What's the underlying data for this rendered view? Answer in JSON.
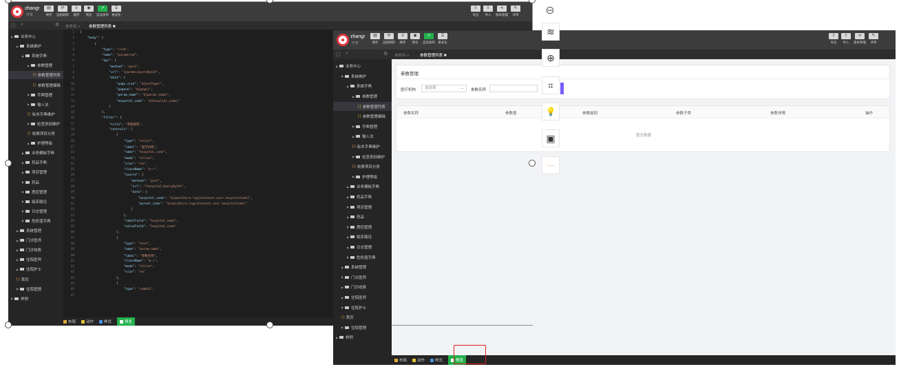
{
  "user": {
    "name": "zhangr",
    "role": "开发"
  },
  "toolbar_left": [
    {
      "icon": "save-icon",
      "label": "保存"
    },
    {
      "icon": "refresh-icon",
      "label": "远程刷新"
    },
    {
      "icon": "sort-icon",
      "label": "顺序"
    },
    {
      "icon": "eye-icon",
      "label": "预览"
    },
    {
      "icon": "publish-icon",
      "label": "自动发布"
    },
    {
      "icon": "format-icon",
      "label": "格式化"
    }
  ],
  "toolbar_right": [
    {
      "icon": "export-icon",
      "label": "导出"
    },
    {
      "icon": "import-icon",
      "label": "导入"
    },
    {
      "icon": "version-icon",
      "label": "版本管理"
    },
    {
      "icon": "review-icon",
      "label": "评审"
    }
  ],
  "tabs": [
    {
      "label": "未命名",
      "close": "×",
      "active": false
    },
    {
      "label": "参数管理列表",
      "close": "✖",
      "active": true
    }
  ],
  "tree_back": [
    {
      "d": 0,
      "t": "open",
      "label": "业务中心"
    },
    {
      "d": 1,
      "t": "open",
      "label": "系统维护"
    },
    {
      "d": 2,
      "t": "open",
      "label": "系统字典"
    },
    {
      "d": 3,
      "t": "open",
      "label": "参数管理"
    },
    {
      "d": 4,
      "t": "code",
      "label": "参数管理列表",
      "sel": true
    },
    {
      "d": 4,
      "t": "code",
      "label": "参数管理编辑"
    },
    {
      "d": 3,
      "t": "folder",
      "label": "字典管理"
    },
    {
      "d": 3,
      "t": "folder",
      "label": "输入法"
    },
    {
      "d": 3,
      "t": "code",
      "label": "标本字典维护"
    },
    {
      "d": 3,
      "t": "folder",
      "label": "检查类别维护"
    },
    {
      "d": 3,
      "t": "code",
      "label": "收费项目分类"
    },
    {
      "d": 3,
      "t": "folder",
      "label": "护理等级"
    },
    {
      "d": 2,
      "t": "folder",
      "label": "业务模板字典"
    },
    {
      "d": 2,
      "t": "folder",
      "label": "药品字典"
    },
    {
      "d": 2,
      "t": "folder",
      "label": "项目管理"
    },
    {
      "d": 2,
      "t": "folder",
      "label": "药品"
    },
    {
      "d": 2,
      "t": "folder",
      "label": "质控管理"
    },
    {
      "d": 2,
      "t": "folder",
      "label": "临床路径"
    },
    {
      "d": 2,
      "t": "folder",
      "label": "日志管理"
    },
    {
      "d": 2,
      "t": "folder",
      "label": "危机值字典"
    },
    {
      "d": 1,
      "t": "folder",
      "label": "系统管理"
    },
    {
      "d": 1,
      "t": "folder",
      "label": "门诊医师"
    },
    {
      "d": 1,
      "t": "folder",
      "label": "门诊收费"
    },
    {
      "d": 1,
      "t": "folder",
      "label": "住院医师"
    },
    {
      "d": 1,
      "t": "folder",
      "label": "住院护士"
    },
    {
      "d": 1,
      "t": "code",
      "label": "首页"
    },
    {
      "d": 1,
      "t": "folder",
      "label": "住院管理"
    },
    {
      "d": 0,
      "t": "folder",
      "label": "样例"
    }
  ],
  "line_numbers": [
    "1",
    "2",
    "3",
    "4",
    "5",
    "6",
    "7",
    "8",
    "9",
    "10",
    "11",
    "12",
    "13",
    "14",
    "15",
    "16",
    "17",
    "18",
    "19",
    "20",
    "21",
    "22",
    "23",
    "24",
    "25",
    "26",
    "27",
    "28",
    "29",
    "30",
    "31",
    "32",
    "33",
    "34",
    "35",
    "36",
    "37",
    "38",
    "39",
    "40",
    "41",
    "42",
    "43",
    "44",
    "45",
    "46",
    "47"
  ],
  "code_lines": [
    [
      [
        "p",
        "{"
      ]
    ],
    [
      [
        "p",
        "    "
      ],
      [
        "k",
        "\"body\""
      ],
      [
        "p",
        ": ["
      ]
    ],
    [
      [
        "p",
        "        {"
      ]
    ],
    [
      [
        "p",
        "            "
      ],
      [
        "k",
        "\"type\""
      ],
      [
        "p",
        ": "
      ],
      [
        "s",
        "\"crud\""
      ],
      [
        "p",
        ","
      ]
    ],
    [
      [
        "p",
        "            "
      ],
      [
        "k",
        "\"name\""
      ],
      [
        "p",
        ": "
      ],
      [
        "s",
        "\"paramcrud\""
      ],
      [
        "p",
        ","
      ]
    ],
    [
      [
        "p",
        "            "
      ],
      [
        "k",
        "\"api\""
      ],
      [
        "p",
        ": {"
      ]
    ],
    [
      [
        "p",
        "                "
      ],
      [
        "k",
        "\"method\""
      ],
      [
        "p",
        ": "
      ],
      [
        "s",
        "\"post\""
      ],
      [
        "p",
        ","
      ]
    ],
    [
      [
        "p",
        "                "
      ],
      [
        "k",
        "\"url\""
      ],
      [
        "p",
        ": "
      ],
      [
        "s",
        "\"/params/queryByCdt\""
      ],
      [
        "p",
        ","
      ]
    ],
    [
      [
        "p",
        "                "
      ],
      [
        "k",
        "\"data\""
      ],
      [
        "p",
        ": {"
      ]
    ],
    [
      [
        "p",
        "                    "
      ],
      [
        "k",
        "\"page_size\""
      ],
      [
        "p",
        ": "
      ],
      [
        "s",
        "\"${perPage}\""
      ],
      [
        "p",
        ","
      ]
    ],
    [
      [
        "p",
        "                    "
      ],
      [
        "k",
        "\"pageno\""
      ],
      [
        "p",
        ": "
      ],
      [
        "s",
        "\"${page}\""
      ],
      [
        "p",
        ","
      ]
    ],
    [
      [
        "p",
        "                    "
      ],
      [
        "k",
        "\"param_name\""
      ],
      [
        "p",
        ": "
      ],
      [
        "s",
        "\"${param_name}\""
      ],
      [
        "p",
        ","
      ]
    ],
    [
      [
        "p",
        "                    "
      ],
      [
        "k",
        "\"hospital_code\""
      ],
      [
        "p",
        ": "
      ],
      [
        "s",
        "\"${hospital_code}\""
      ]
    ],
    [
      [
        "p",
        "                }"
      ]
    ],
    [
      [
        "p",
        "            },"
      ]
    ],
    [
      [
        "p",
        "            "
      ],
      [
        "k",
        "\"filter\""
      ],
      [
        "p",
        ": {"
      ]
    ],
    [
      [
        "p",
        "                "
      ],
      [
        "k",
        "\"title\""
      ],
      [
        "p",
        ": "
      ],
      [
        "s",
        "\"参数管理\""
      ],
      [
        "p",
        ","
      ]
    ],
    [
      [
        "p",
        "                "
      ],
      [
        "k",
        "\"controls\""
      ],
      [
        "p",
        ": ["
      ]
    ],
    [
      [
        "p",
        "                    {"
      ]
    ],
    [
      [
        "p",
        "                        "
      ],
      [
        "k",
        "\"type\""
      ],
      [
        "p",
        ": "
      ],
      [
        "s",
        "\"select\""
      ],
      [
        "p",
        ","
      ]
    ],
    [
      [
        "p",
        "                        "
      ],
      [
        "k",
        "\"label\""
      ],
      [
        "p",
        ": "
      ],
      [
        "s",
        "\"医疗机构\""
      ],
      [
        "p",
        ","
      ]
    ],
    [
      [
        "p",
        "                        "
      ],
      [
        "k",
        "\"name\""
      ],
      [
        "p",
        ": "
      ],
      [
        "s",
        "\"hospital_code\""
      ],
      [
        "p",
        ","
      ]
    ],
    [
      [
        "p",
        "                        "
      ],
      [
        "k",
        "\"mode\""
      ],
      [
        "p",
        ": "
      ],
      [
        "s",
        "\"inline\""
      ],
      [
        "p",
        ","
      ]
    ],
    [
      [
        "p",
        "                        "
      ],
      [
        "k",
        "\"size\""
      ],
      [
        "p",
        ": "
      ],
      [
        "s",
        "\"sm\""
      ],
      [
        "p",
        ","
      ]
    ],
    [
      [
        "p",
        "                        "
      ],
      [
        "k",
        "\"className\""
      ],
      [
        "p",
        ": "
      ],
      [
        "s",
        "\"m-r\""
      ],
      [
        "p",
        ","
      ]
    ],
    [
      [
        "p",
        "                        "
      ],
      [
        "k",
        "\"source\""
      ],
      [
        "p",
        ": {"
      ]
    ],
    [
      [
        "p",
        "                            "
      ],
      [
        "k",
        "\"method\""
      ],
      [
        "p",
        ": "
      ],
      [
        "s",
        "\"post\""
      ],
      [
        "p",
        ","
      ]
    ],
    [
      [
        "p",
        "                            "
      ],
      [
        "k",
        "\"url\""
      ],
      [
        "p",
        ": "
      ],
      [
        "s",
        "\"/hospital/queryByCdt\""
      ],
      [
        "p",
        ","
      ]
    ],
    [
      [
        "p",
        "                            "
      ],
      [
        "k",
        "\"data\""
      ],
      [
        "p",
        ": {"
      ]
    ],
    [
      [
        "p",
        "                                "
      ],
      [
        "k",
        "\"hospital_code\""
      ],
      [
        "p",
        ": "
      ],
      [
        "s",
        "\"${amisStore.loginContext.user.hospitalCode}\""
      ],
      [
        "p",
        ","
      ]
    ],
    [
      [
        "p",
        "                                "
      ],
      [
        "k",
        "\"parent_code\""
      ],
      [
        "p",
        ": "
      ],
      [
        "s",
        "\"${amisStore.loginContext.user.hospitalCode}\""
      ]
    ],
    [
      [
        "p",
        "                            }"
      ]
    ],
    [
      [
        "p",
        "                        },"
      ]
    ],
    [
      [
        "p",
        "                        "
      ],
      [
        "k",
        "\"labelField\""
      ],
      [
        "p",
        ": "
      ],
      [
        "s",
        "\"hospital_name\""
      ],
      [
        "p",
        ","
      ]
    ],
    [
      [
        "p",
        "                        "
      ],
      [
        "k",
        "\"valueField\""
      ],
      [
        "p",
        ": "
      ],
      [
        "s",
        "\"hospital_code\""
      ]
    ],
    [
      [
        "p",
        "                    },"
      ]
    ],
    [
      [
        "p",
        "                    {"
      ]
    ],
    [
      [
        "p",
        "                        "
      ],
      [
        "k",
        "\"type\""
      ],
      [
        "p",
        ": "
      ],
      [
        "s",
        "\"text\""
      ],
      [
        "p",
        ","
      ]
    ],
    [
      [
        "p",
        "                        "
      ],
      [
        "k",
        "\"name\""
      ],
      [
        "p",
        ": "
      ],
      [
        "s",
        "\"param_name\""
      ],
      [
        "p",
        ","
      ]
    ],
    [
      [
        "p",
        "                        "
      ],
      [
        "k",
        "\"label\""
      ],
      [
        "p",
        ": "
      ],
      [
        "s",
        "\"参数名称\""
      ],
      [
        "p",
        ","
      ]
    ],
    [
      [
        "p",
        "                        "
      ],
      [
        "k",
        "\"className\""
      ],
      [
        "p",
        ": "
      ],
      [
        "s",
        "\"m-r\""
      ],
      [
        "p",
        ","
      ]
    ],
    [
      [
        "p",
        "                        "
      ],
      [
        "k",
        "\"mode\""
      ],
      [
        "p",
        ": "
      ],
      [
        "s",
        "\"inline\""
      ],
      [
        "p",
        ","
      ]
    ],
    [
      [
        "p",
        "                        "
      ],
      [
        "k",
        "\"size\""
      ],
      [
        "p",
        ": "
      ],
      [
        "s",
        "\"sm\""
      ]
    ],
    [
      [
        "p",
        "                    },"
      ]
    ],
    [
      [
        "p",
        "                    {"
      ]
    ],
    [
      [
        "p",
        "                        "
      ],
      [
        "k",
        "\"type\""
      ],
      [
        "p",
        ": "
      ],
      [
        "s",
        "\"submit\""
      ],
      [
        "p",
        ","
      ]
    ]
  ],
  "bottom_tabs": [
    {
      "icon": "layout-icon",
      "label": "布局",
      "on": false
    },
    {
      "icon": "action-icon",
      "label": "动作",
      "on": false
    },
    {
      "icon": "style-icon",
      "label": "样式",
      "on": false
    },
    {
      "icon": "preview-icon",
      "label": "预览",
      "on": true
    }
  ],
  "preview": {
    "title": "参数管理",
    "filter_hospital_label": "医疗机构",
    "filter_hospital_placeholder": "请选择",
    "filter_param_label": "参数名称",
    "columns": [
      "参数名称",
      "参数值",
      "参数级别",
      "参数子类",
      "参数详情",
      "操作"
    ],
    "empty_text": "暂无数据"
  },
  "side_tools": [
    {
      "icon": "minus-circle-icon",
      "glyph": "⊖"
    },
    {
      "icon": "layers-icon",
      "glyph": "≋"
    },
    {
      "icon": "zoom-in-icon",
      "glyph": "⊕"
    },
    {
      "icon": "crop-icon",
      "glyph": "⌗"
    },
    {
      "icon": "lightbulb-icon",
      "glyph": "💡"
    },
    {
      "icon": "image-word-icon",
      "glyph": "▣"
    },
    {
      "icon": "more-icon",
      "glyph": "···"
    }
  ],
  "colors": {
    "accent_green": "#22b14c",
    "highlight_red": "#e02020",
    "selection_purple": "#7a5cff"
  }
}
